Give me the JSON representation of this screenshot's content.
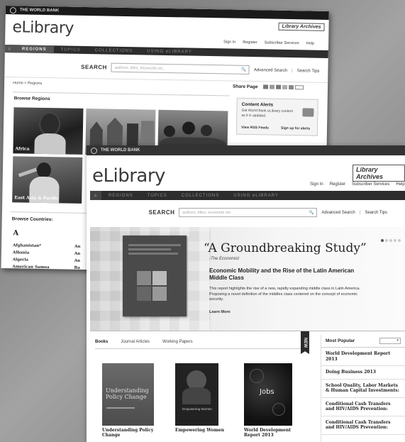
{
  "back": {
    "wb_label": "THE WORLD BANK",
    "logo_main": "eLibrary",
    "library_archives": "Library Archives",
    "util": [
      "Sign In",
      "Register",
      "Subscriber Services",
      "Help"
    ],
    "nav": [
      "REGIONS",
      "TOPICS",
      "COLLECTIONS",
      "USING eLIBRARY"
    ],
    "search_label": "SEARCH",
    "search_placeholder": "authors, titles, keywords etc.",
    "advanced": "Advanced Search",
    "tips": "Search Tips",
    "crumb": "Home > Regions",
    "share": "Share Page",
    "browse_regions": "Browse Regions",
    "regions": [
      "Africa",
      "",
      "",
      "East Asia & Pacific"
    ],
    "alerts_title": "Content Alerts",
    "alerts_text": "Get World Bank eLibrary content as it is updated.",
    "rss": "View RSS Feeds",
    "signup": "Sign up for alerts",
    "browse_countries": "Browse Countries:",
    "letter": "A",
    "countries": [
      "Afghanistan*",
      "Albania",
      "Algeria",
      "American Samoa"
    ],
    "countries_col2": [
      "An",
      "An",
      "An",
      "Ba"
    ]
  },
  "front": {
    "wb_label": "THE WORLD BANK",
    "logo_main": "eLibrary",
    "library_archives": "Library Archives",
    "util": [
      "Sign In",
      "Register",
      "Subscriber Services",
      "Help"
    ],
    "nav": [
      "REGIONS",
      "TOPICS",
      "COLLECTIONS",
      "USING eLIBRARY"
    ],
    "search_label": "SEARCH",
    "search_placeholder": "authors, titles, keywords etc.",
    "advanced": "Advanced Search",
    "tips": "Search Tips",
    "hero_quote": "“A Groundbreaking Study”",
    "hero_source": "-The Economist",
    "hero_title": "Economic Mobility and the Rise of the Latin American Middle Class",
    "hero_body": "This report highlights the rise of a new, rapidly expanding middle class in Latin America. Proposing a novel definition of the middles class centered on the concept of economic security.",
    "learn_more": "Learn More",
    "tabs": [
      "Books",
      "Journal Articles",
      "Working Papers"
    ],
    "new_badge": "NEW",
    "books": [
      {
        "title": "Understanding Policy Change",
        "cover": "Understanding Policy Change"
      },
      {
        "title": "Empowering Women",
        "cover": "Empowering Women"
      },
      {
        "title": "World Development Report 2013",
        "cover": "Jobs"
      }
    ],
    "most_popular": "Most Popular",
    "popular": [
      "World Development Report 2013",
      "Doing Business 2013",
      "School Quality, Labor Markets & Human Capital Investments:",
      "Conditional Cash Transfers and HIV/AIDS Prevention:",
      "Conditional Cash Transfers and HIV/AIDS Prevention:"
    ]
  }
}
